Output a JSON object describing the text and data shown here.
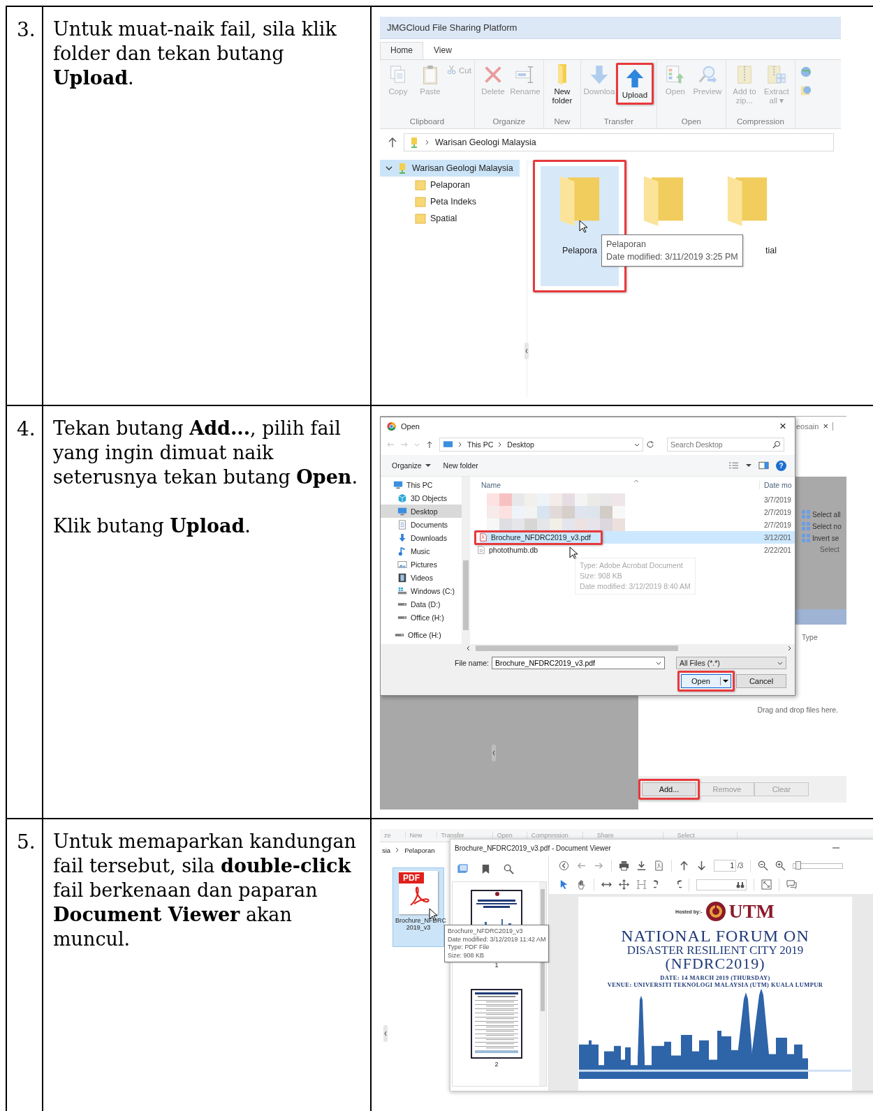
{
  "steps": [
    {
      "number": "3.",
      "paragraphs": [
        "Untuk muat-naik fail, sila klik folder dan tekan butang **Upload**."
      ],
      "screenshot": {
        "kind": "explorer",
        "title": "JMGCloud File Sharing Platform",
        "tabs": [
          {
            "label": "Home",
            "selected": true
          },
          {
            "label": "View",
            "selected": false
          }
        ],
        "ribbon_groups": [
          {
            "label": "Clipboard",
            "buttons": [
              {
                "kind": "copy",
                "label": "Copy",
                "disabled": true,
                "highlighted": false
              },
              {
                "kind": "paste",
                "label": "Paste",
                "disabled": true,
                "highlighted": false
              },
              {
                "kind": "cut",
                "label": "Cut",
                "disabled": true,
                "highlighted": false
              }
            ]
          },
          {
            "label": "Organize",
            "buttons": [
              {
                "kind": "delete",
                "label": "Delete",
                "disabled": true,
                "highlighted": false
              },
              {
                "kind": "rename",
                "label": "Rename",
                "disabled": true,
                "highlighted": false
              }
            ]
          },
          {
            "label": "New",
            "buttons": [
              {
                "kind": "new_folder",
                "label": "New folder",
                "disabled": false,
                "highlighted": false
              }
            ]
          },
          {
            "label": "Transfer",
            "buttons": [
              {
                "kind": "download",
                "label": "Downloa",
                "disabled": true,
                "highlighted": false
              },
              {
                "kind": "upload",
                "label": "Upload",
                "disabled": false,
                "highlighted": true
              }
            ]
          },
          {
            "label": "Open",
            "buttons": [
              {
                "kind": "open",
                "label": "Open",
                "disabled": true,
                "highlighted": false
              },
              {
                "kind": "preview",
                "label": "Preview",
                "disabled": true,
                "highlighted": false
              }
            ]
          },
          {
            "label": "Compression",
            "buttons": [
              {
                "kind": "zip",
                "label": "Add to zip...",
                "disabled": true,
                "highlighted": false
              },
              {
                "kind": "extract",
                "label": "Extract all ▾",
                "disabled": true,
                "highlighted": false
              }
            ]
          }
        ],
        "address": "Warisan Geologi Malaysia",
        "tree": {
          "label": "Warisan Geologi Malaysia",
          "expanded": true,
          "selected": true,
          "children": [
            {
              "label": "Pelaporan"
            },
            {
              "label": "Peta Indeks"
            },
            {
              "label": "Spatial"
            }
          ]
        },
        "folders": [
          {
            "label": "Pelapora",
            "selected": true,
            "highlighted": true
          },
          {
            "selected": false,
            "highlighted": false
          },
          {
            "label": "tial",
            "selected": false,
            "highlighted": false
          }
        ],
        "tooltip": [
          "Pelaporan",
          "Date modified: 3/11/2019 3:25 PM"
        ]
      }
    },
    {
      "number": "4.",
      "paragraphs": [
        "Tekan butang **Add...**, pilih fail yang ingin dimuat naik seterusnya tekan butang **Open**.",
        "Klik butang **Upload**."
      ],
      "screenshot": {
        "kind": "open_dialog",
        "app": {
          "tab_label": "eosain",
          "tab_close": "×",
          "select_actions": [
            "Select all",
            "Select no",
            "Invert se"
          ],
          "select_group": "Select",
          "column": "Type",
          "drop_hint": "Drag and drop files here.",
          "buttons": [
            {
              "label": "Add...",
              "disabled": false,
              "highlighted": true
            },
            {
              "label": "Remove",
              "disabled": true,
              "highlighted": false
            },
            {
              "label": "Clear",
              "disabled": true,
              "highlighted": false
            }
          ]
        },
        "dialog": {
          "title": "Open",
          "close": "×",
          "path": [
            "This PC",
            "Desktop"
          ],
          "search_placeholder": "Search Desktop",
          "toolbar": [
            "Organize",
            "New folder"
          ],
          "help": "?",
          "nav": [
            {
              "kind": "pc",
              "label": "This PC",
              "selected": false
            },
            {
              "kind": "cube",
              "label": "3D Objects",
              "selected": false
            },
            {
              "kind": "desktop",
              "label": "Desktop",
              "selected": true
            },
            {
              "kind": "docs",
              "label": "Documents",
              "selected": false
            },
            {
              "kind": "downloads",
              "label": "Downloads",
              "selected": false
            },
            {
              "kind": "music",
              "label": "Music",
              "selected": false
            },
            {
              "kind": "pictures",
              "label": "Pictures",
              "selected": false
            },
            {
              "kind": "videos",
              "label": "Videos",
              "selected": false
            },
            {
              "kind": "windows_drive",
              "label": "Windows (C:)",
              "selected": false
            },
            {
              "kind": "drive",
              "label": "Data (D:)",
              "selected": false
            },
            {
              "kind": "drive",
              "label": "Office (H:)",
              "selected": false
            },
            {
              "kind": "drive",
              "label": "Office (H:)",
              "selected": false
            }
          ],
          "columns": [
            "Name",
            "Date mo"
          ],
          "files": [
            {
              "kind": "blurred",
              "date": "3/7/2019",
              "selected": false,
              "highlighted": false
            },
            {
              "kind": "blurred",
              "date": "2/7/2019",
              "selected": false,
              "highlighted": false
            },
            {
              "kind": "blurred",
              "date": "2/7/2019",
              "selected": false,
              "highlighted": false
            },
            {
              "kind": "pdf",
              "name": "Brochure_NFDRC2019_v3.pdf",
              "date": "3/12/201",
              "selected": true,
              "highlighted": true
            },
            {
              "kind": "db",
              "name": "photothumb.db",
              "date": "2/22/201",
              "selected": false,
              "highlighted": false
            }
          ],
          "hover_tip": [
            "Type: Adobe Acrobat Document",
            "Size: 908 KB",
            "Date modified: 3/12/2019 8:40 AM"
          ],
          "file_name_label": "File name:",
          "file_name": "Brochure_NFDRC2019_v3.pdf",
          "filter": "All Files (*.*)",
          "buttons": [
            {
              "kind": "split",
              "label": "Open",
              "highlighted": true
            },
            {
              "kind": "plain",
              "label": "Cancel",
              "highlighted": false
            }
          ]
        }
      }
    },
    {
      "number": "5.",
      "paragraphs": [
        "Untuk memaparkan kandungan fail tersebut, sila **double-click** fail berkenaan dan paparan **Document Viewer** akan muncul."
      ],
      "screenshot": {
        "kind": "viewer",
        "explorer": {
          "ribbon_labels": [
            "ze",
            "New",
            "Transfer",
            "Open",
            "Compression",
            "Share",
            "Select"
          ],
          "path": [
            "sia",
            "Pelaporan"
          ],
          "file": {
            "badge": "PDF",
            "label": "Brochure_NFDRC 2019_v3",
            "selected": true
          },
          "tooltip": [
            "Brochure_NFDRC2019_v3",
            "Date modified: 3/12/2019 11:42 AM",
            "Type: PDF File",
            "Size: 908 KB"
          ]
        },
        "viewer": {
          "title": "Brochure_NFDRC2019_v3.pdf - Document Viewer",
          "page": "1",
          "page_total": "/3",
          "zoom": {
            "level": 0.1
          },
          "thumbnails": [
            {
              "label": "1"
            },
            {
              "label": "2"
            }
          ],
          "document": {
            "hosted_by": "Hosted by:-",
            "logo": "UTM",
            "title_lines": [
              "NATIONAL FORUM ON",
              "DISASTER RESILIENT CITY 2019",
              "(NFDRC2019)"
            ],
            "details": [
              "DATE: 14 MARCH 2019 (THURSDAY)",
              "VENUE: UNIVERSITI TEKNOLOGI MALAYSIA (UTM) KUALA LUMPUR"
            ]
          }
        }
      }
    }
  ]
}
